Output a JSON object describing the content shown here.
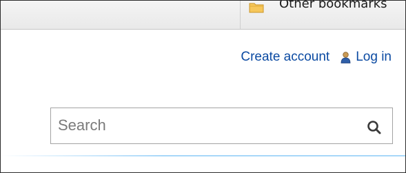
{
  "bookmarks_bar": {
    "other_bookmarks_label": "Other bookmarks",
    "folder_color": "#f5c553"
  },
  "personal": {
    "create_account": "Create account",
    "log_in": "Log in",
    "link_color": "#0b4aa2",
    "user_icon": "user-icon"
  },
  "search": {
    "placeholder": "Search",
    "value": "",
    "button_icon": "search-icon"
  }
}
